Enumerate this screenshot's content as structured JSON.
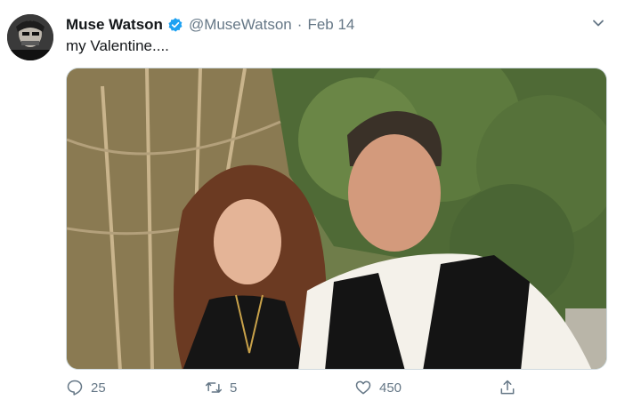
{
  "tweet": {
    "display_name": "Muse Watson",
    "handle": "@MuseWatson",
    "separator": "·",
    "date": "Feb 14",
    "text": "my Valentine....",
    "avatar_icon": "profile-photo",
    "verified_icon": "verified-badge-icon",
    "media_alt_icon": "photo-couple-outdoors",
    "counts": {
      "replies": "25",
      "retweets": "5",
      "likes": "450"
    }
  },
  "colors": {
    "accent": "#1da1f2",
    "text_primary": "#14171a",
    "text_secondary": "#657786"
  }
}
